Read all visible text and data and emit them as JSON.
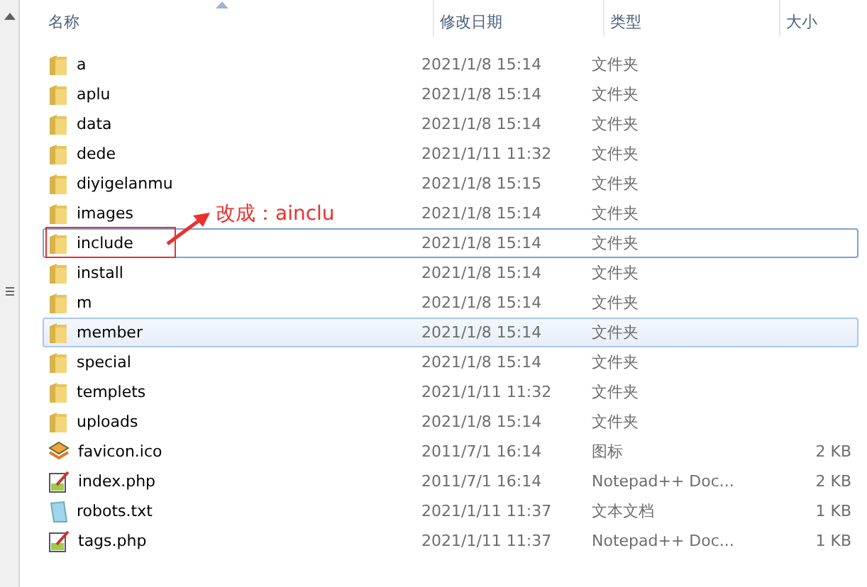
{
  "columns": [
    "名称",
    "修改日期",
    "类型",
    "大小"
  ],
  "sort": {
    "ascending": true
  },
  "files": [
    {
      "kind": "folder",
      "name": "a",
      "date": "2021/1/8 15:14",
      "type": "文件夹",
      "selected": false,
      "focused": false,
      "marked": false
    },
    {
      "kind": "folder",
      "name": "aplu",
      "date": "2021/1/8 15:14",
      "type": "文件夹",
      "selected": false,
      "focused": false,
      "marked": false
    },
    {
      "kind": "folder",
      "name": "data",
      "date": "2021/1/8 15:14",
      "type": "文件夹",
      "selected": false,
      "focused": false,
      "marked": false
    },
    {
      "kind": "folder",
      "name": "dede",
      "date": "2021/1/11 11:32",
      "type": "文件夹",
      "selected": false,
      "focused": false,
      "marked": false
    },
    {
      "kind": "folder",
      "name": "diyigelanmu",
      "date": "2021/1/8 15:15",
      "type": "文件夹",
      "selected": false,
      "focused": false,
      "marked": false
    },
    {
      "kind": "folder",
      "name": "images",
      "date": "2021/1/8 15:14",
      "type": "文件夹",
      "selected": false,
      "focused": false,
      "marked": false
    },
    {
      "kind": "folder",
      "name": "include",
      "date": "2021/1/8 15:14",
      "type": "文件夹",
      "selected": false,
      "focused": true,
      "marked": true
    },
    {
      "kind": "folder",
      "name": "install",
      "date": "2021/1/8 15:14",
      "type": "文件夹",
      "selected": false,
      "focused": false,
      "marked": false
    },
    {
      "kind": "folder",
      "name": "m",
      "date": "2021/1/8 15:14",
      "type": "文件夹",
      "selected": false,
      "focused": false,
      "marked": false
    },
    {
      "kind": "folder",
      "name": "member",
      "date": "2021/1/8 15:14",
      "type": "文件夹",
      "selected": true,
      "focused": false,
      "marked": false
    },
    {
      "kind": "folder",
      "name": "special",
      "date": "2021/1/8 15:14",
      "type": "文件夹",
      "selected": false,
      "focused": false,
      "marked": false
    },
    {
      "kind": "folder",
      "name": "templets",
      "date": "2021/1/11 11:32",
      "type": "文件夹",
      "selected": false,
      "focused": false,
      "marked": false
    },
    {
      "kind": "folder",
      "name": "uploads",
      "date": "2021/1/8 15:14",
      "type": "文件夹",
      "selected": false,
      "focused": false,
      "marked": false
    },
    {
      "kind": "icon",
      "name": "favicon.ico",
      "date": "2011/7/1 16:14",
      "type": "图标",
      "size": "2 KB",
      "selected": false,
      "focused": false,
      "marked": false
    },
    {
      "kind": "script",
      "name": "index.php",
      "date": "2011/7/1 16:14",
      "type": "Notepad++ Doc...",
      "size": "2 KB",
      "selected": false,
      "focused": false,
      "marked": false
    },
    {
      "kind": "text",
      "name": "robots.txt",
      "date": "2021/1/11 11:37",
      "type": "文本文档",
      "size": "1 KB",
      "selected": false,
      "focused": false,
      "marked": false
    },
    {
      "kind": "script",
      "name": "tags.php",
      "date": "2021/1/11 11:37",
      "type": "Notepad++ Doc...",
      "size": "1 KB",
      "selected": false,
      "focused": false,
      "marked": false
    }
  ],
  "annotation": {
    "text": "改成：ainclu"
  }
}
